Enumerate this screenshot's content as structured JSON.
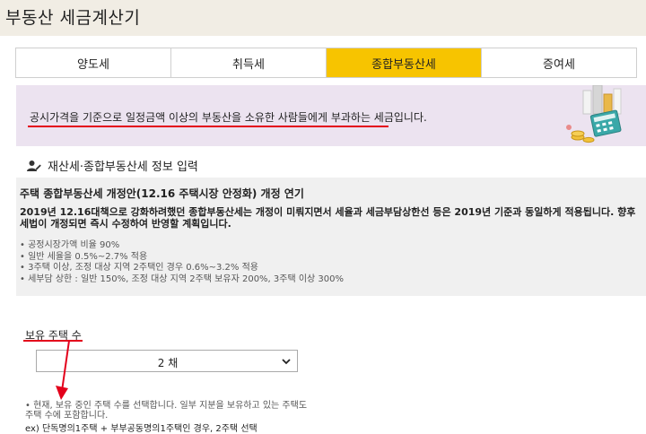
{
  "app": {
    "title": "부동산 세금계산기"
  },
  "tabs": [
    {
      "label": "양도세",
      "active": false
    },
    {
      "label": "취득세",
      "active": false
    },
    {
      "label": "종합부동산세",
      "active": true
    },
    {
      "label": "증여세",
      "active": false
    }
  ],
  "banner": {
    "text": "공시가격을 기준으로 일정금액 이상의 부동산을 소유한 사람들에게 부과하는 세금입니다."
  },
  "section": {
    "title": "재산세·종합부동산세 정보 입력",
    "icon": "user-edit-icon"
  },
  "notice": {
    "title": "주택 종합부동산세 개정안(12.16 주택시장 안정화) 개정 연기",
    "paragraph": "2019년 12.16대책으로 강화하려했던 종합부동산세는 개정이 미뤄지면서 세율과 세금부담상한선 등은 2019년 기준과 동일하게 적용됩니다. 향후 세법이 개정되면 즉시 수정하여 반영할 계획입니다.",
    "items": [
      "• 공정시장가액 비율 90%",
      "• 일반 세율을 0.5%~2.7% 적용",
      "• 3주택 이상, 조정 대상 지역 2주택인 경우 0.6%~3.2% 적용",
      "• 세부담 상한 : 일반 150%, 조정 대상 지역 2주택 보유자 200%, 3주택 이상 300%"
    ]
  },
  "field": {
    "label": "보유 주택 수",
    "selected": "2 채",
    "help": "• 현재, 보유 중인 주택 수를 선택합니다. 일부 지분을 보유하고 있는 주택도 주택 수에 포함합니다.",
    "example": "ex) 단독명의1주택 + 부부공동명의1주택인 경우, 2주택 선택"
  },
  "colors": {
    "accent": "#f7c400",
    "highlight": "#e3001b",
    "banner_bg": "#ece3f0",
    "notice_bg": "#f0f0f0",
    "titlebar_bg": "#f1ede4"
  }
}
